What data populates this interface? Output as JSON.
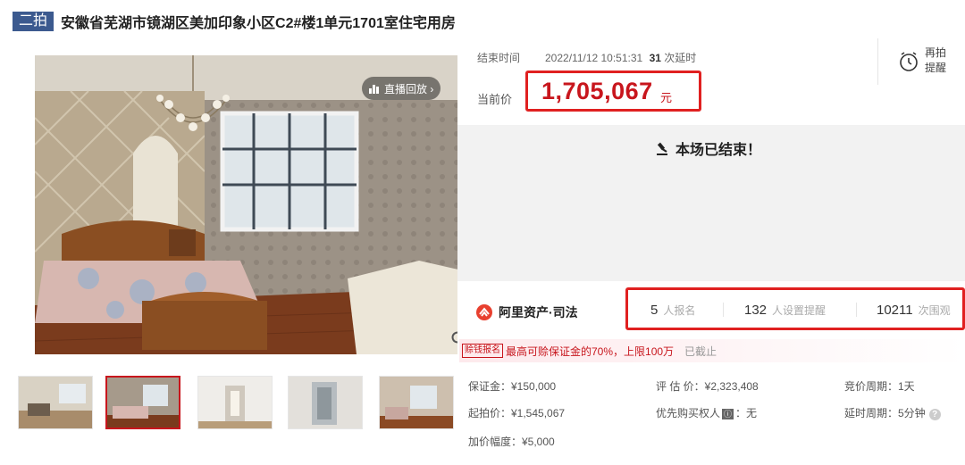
{
  "title": {
    "round": "二拍",
    "text": "安徽省芜湖市镜湖区美加印象小区C2#楼1单元1701室住宅用房"
  },
  "photo": {
    "live_replay_label": "直播回放 ›"
  },
  "thumbnails": [
    {
      "scene": "living-room"
    },
    {
      "scene": "bedroom",
      "active": true
    },
    {
      "scene": "hallway"
    },
    {
      "scene": "bathroom"
    },
    {
      "scene": "room"
    }
  ],
  "auction": {
    "end_label": "结束时间",
    "end_time": "2022/11/12 10:51:31",
    "delay_count": "31",
    "delay_label": "次延时",
    "current_price_label": "当前价",
    "current_price": "1,705,067",
    "price_unit": "元",
    "remind_label_1": "再拍",
    "remind_label_2": "提醒",
    "ended_text": "本场已结束！"
  },
  "stats": {
    "brand": "阿里资产·司法",
    "signups": "5",
    "signups_label": "人报名",
    "reminders": "132",
    "reminders_label": "人设置提醒",
    "views": "10211",
    "views_label": "次围观"
  },
  "notice": {
    "tag": "赊钱报名",
    "main": "最高可赊保证金的70%，上限100万",
    "status": "已截止"
  },
  "details": {
    "deposit": "保证金：¥150,000",
    "appraisal": "评 估 价：¥2,323,408",
    "bid_period": "竞价周期：1天",
    "start_price": "起拍价：¥1,545,067",
    "priority_label": "优先购买权人",
    "priority_badge": "ⓘ",
    "priority_value": "：无",
    "delay_period": "延时周期：5分钟",
    "increment": "加价幅度：¥5,000"
  },
  "colors": {
    "accent": "#c8161d",
    "badge": "#3c5a8f",
    "highlight_border": "#e02020"
  }
}
